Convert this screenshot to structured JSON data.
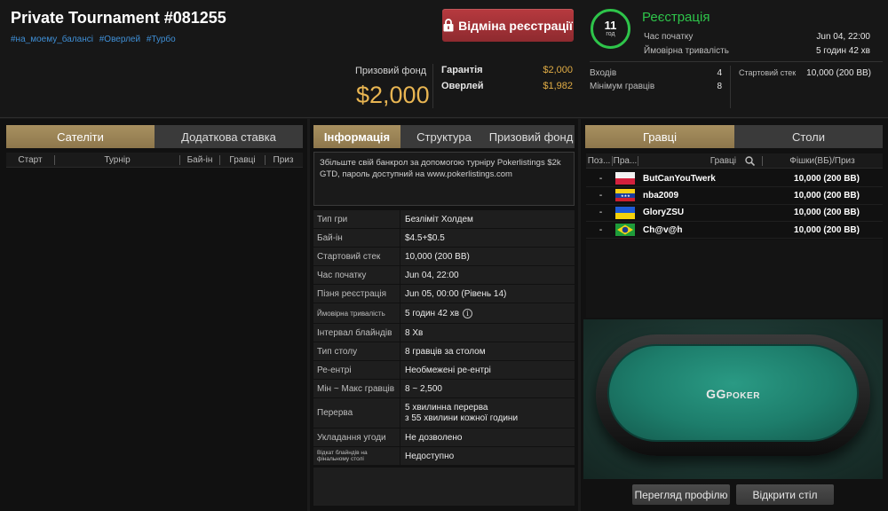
{
  "header": {
    "title": "Private Tournament #081255",
    "tags": [
      "#на_моему_балансі",
      "#Оверлей",
      "#Турбо"
    ],
    "cancel_label": "Відміна реєстрації",
    "prize_label": "Призовий фонд",
    "prize_value": "$2,000",
    "guarantee_label": "Гарантія",
    "guarantee_value": "$2,000",
    "overlay_label": "Оверлей",
    "overlay_value": "$1,982",
    "timer_value": "11",
    "timer_unit": "год",
    "status": "Реєстрація",
    "start_label": "Час початку",
    "start_value": "Jun 04, 22:00",
    "duration_label": "Ймовірна тривалість",
    "duration_value": "5 годин 42 хв",
    "entries_label": "Входів",
    "entries_value": "4",
    "min_players_label": "Мінімум гравців",
    "min_players_value": "8",
    "start_stack_label": "Стартовий стек",
    "start_stack_value": "10,000 (200 BB)"
  },
  "left": {
    "tabs": [
      "Сателіти",
      "Додаткова ставка"
    ],
    "columns": [
      "Старт",
      "Турнір",
      "Бай-ін",
      "Гравці",
      "Приз"
    ]
  },
  "middle": {
    "tabs": [
      "Інформація",
      "Структура",
      "Призовий фонд"
    ],
    "description": "Збільште свій банкрол за допомогою турніру Pokerlistings $2k GTD, пароль доступний на www.pokerlistings.com",
    "rows": [
      {
        "k": "Тип гри",
        "v": "Безліміт Холдем"
      },
      {
        "k": "Бай-ін",
        "v": "$4.5+$0.5"
      },
      {
        "k": "Стартовий стек",
        "v": "10,000 (200 BB)"
      },
      {
        "k": "Час початку",
        "v": "Jun 04, 22:00"
      },
      {
        "k": "Пізня реєстрація",
        "v": "Jun 05, 00:00 (Рівень 14)"
      },
      {
        "k": "Ймовірна тривалість",
        "v": "5 годин 42 хв"
      },
      {
        "k": "Інтервал блайндів",
        "v": "8 Хв"
      },
      {
        "k": "Тип столу",
        "v": "8 гравців за столом"
      },
      {
        "k": "Ре-ентрі",
        "v": "Необмежені ре-ентрі"
      },
      {
        "k": "Мін ~ Макс гравців",
        "v": "8 ~ 2,500"
      },
      {
        "k": "Перерва",
        "v": "5 хвилинна перерва",
        "v2": "з 55 хвилини кожної години"
      },
      {
        "k": "Укладання угоди",
        "v": "Не дозволено"
      },
      {
        "k": "Відкат блайндів на фінальному столі",
        "v": "Недоступно"
      }
    ]
  },
  "right": {
    "tabs": [
      "Гравці",
      "Столи"
    ],
    "columns": [
      "Поз...",
      "Пра...",
      "Гравці",
      "Фішки(ВБ)/Приз"
    ],
    "players": [
      {
        "pos": "-",
        "flag": "poland",
        "name": "ButCanYouTwerk",
        "chips": "10,000 (200 BB)"
      },
      {
        "pos": "-",
        "flag": "venezuela",
        "name": "nba2009",
        "chips": "10,000 (200 BB)"
      },
      {
        "pos": "-",
        "flag": "ukraine",
        "name": "GloryZSU",
        "chips": "10,000 (200 BB)"
      },
      {
        "pos": "-",
        "flag": "brazil",
        "name": "Ch@v@h",
        "chips": "10,000 (200 BB)"
      }
    ],
    "logo_main": "GG",
    "logo_sub": "POKER",
    "view_profile_label": "Перегляд профілю",
    "open_table_label": "Відкрити стіл"
  }
}
